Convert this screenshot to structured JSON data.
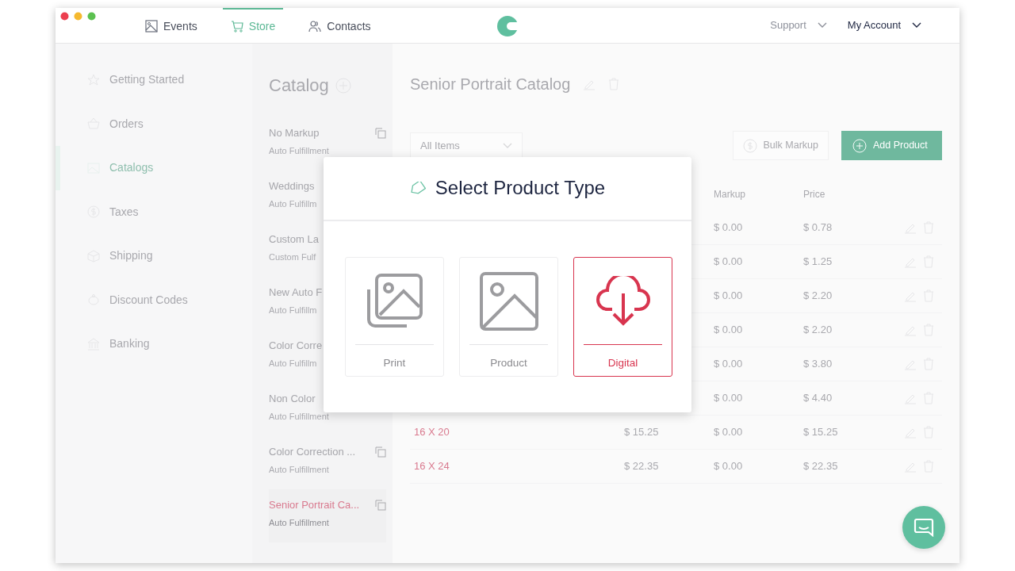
{
  "nav": {
    "tabs": [
      {
        "label": "Events",
        "selected": false
      },
      {
        "label": "Store",
        "selected": true
      },
      {
        "label": "Contacts",
        "selected": false
      }
    ],
    "menus": [
      {
        "label": "Support"
      },
      {
        "label": "My Account"
      }
    ]
  },
  "sidebar": {
    "items": [
      {
        "label": "Getting Started",
        "selected": false
      },
      {
        "label": "Orders",
        "selected": false
      },
      {
        "label": "Catalogs",
        "selected": true
      },
      {
        "label": "Taxes",
        "selected": false
      },
      {
        "label": "Shipping",
        "selected": false
      },
      {
        "label": "Discount Codes",
        "selected": false
      },
      {
        "label": "Banking",
        "selected": false
      }
    ]
  },
  "catalog_list": {
    "title": "Catalog",
    "items": [
      {
        "name": "No Markup",
        "sub": "Auto Fulfillment",
        "copy": true,
        "selected": false
      },
      {
        "name": "Weddings",
        "sub": "Auto Fulfillm",
        "selected": false
      },
      {
        "name": "Custom La",
        "sub": "Custom Fulf",
        "selected": false
      },
      {
        "name": "New Auto F",
        "sub": "Auto Fulfillm",
        "selected": false
      },
      {
        "name": "Color Corre",
        "sub": "Auto Fulfillm",
        "selected": false
      },
      {
        "name": "Non Color",
        "sub": "Auto Fulfillment",
        "selected": false
      },
      {
        "name": "Color Correction ...",
        "sub": "Auto Fulfillment",
        "copy": true,
        "selected": false
      },
      {
        "name": "Senior Portrait Ca...",
        "sub": "Auto Fulfillment",
        "copy": true,
        "selected": true
      }
    ]
  },
  "catalog": {
    "title": "Senior Portrait Catalog",
    "filter": "All Items",
    "buttons": [
      "Bulk Markup",
      "Add Product"
    ],
    "table": {
      "columns": [
        "Markup",
        "Price"
      ],
      "rows": [
        {
          "markup": "$ 0.00",
          "price": "$ 0.78"
        },
        {
          "markup": "$ 0.00",
          "price": "$ 1.25"
        },
        {
          "markup": "$ 0.00",
          "price": "$ 2.20"
        },
        {
          "markup": "$ 0.00",
          "price": "$ 2.20"
        },
        {
          "markup": "$ 0.00",
          "price": "$ 3.80"
        },
        {
          "markup": "$ 0.00",
          "price": "$ 4.40"
        },
        {
          "name": "16 X 20",
          "cost": "$ 15.25",
          "markup": "$ 0.00",
          "price": "$ 15.25"
        },
        {
          "name": "16 X 24",
          "cost": "$ 22.35",
          "markup": "$ 0.00",
          "price": "$ 22.35"
        }
      ]
    }
  },
  "modal": {
    "title": "Select Product Type",
    "options": [
      {
        "label": "Print",
        "selected": false
      },
      {
        "label": "Product",
        "selected": false
      },
      {
        "label": "Digital",
        "selected": true
      }
    ]
  }
}
